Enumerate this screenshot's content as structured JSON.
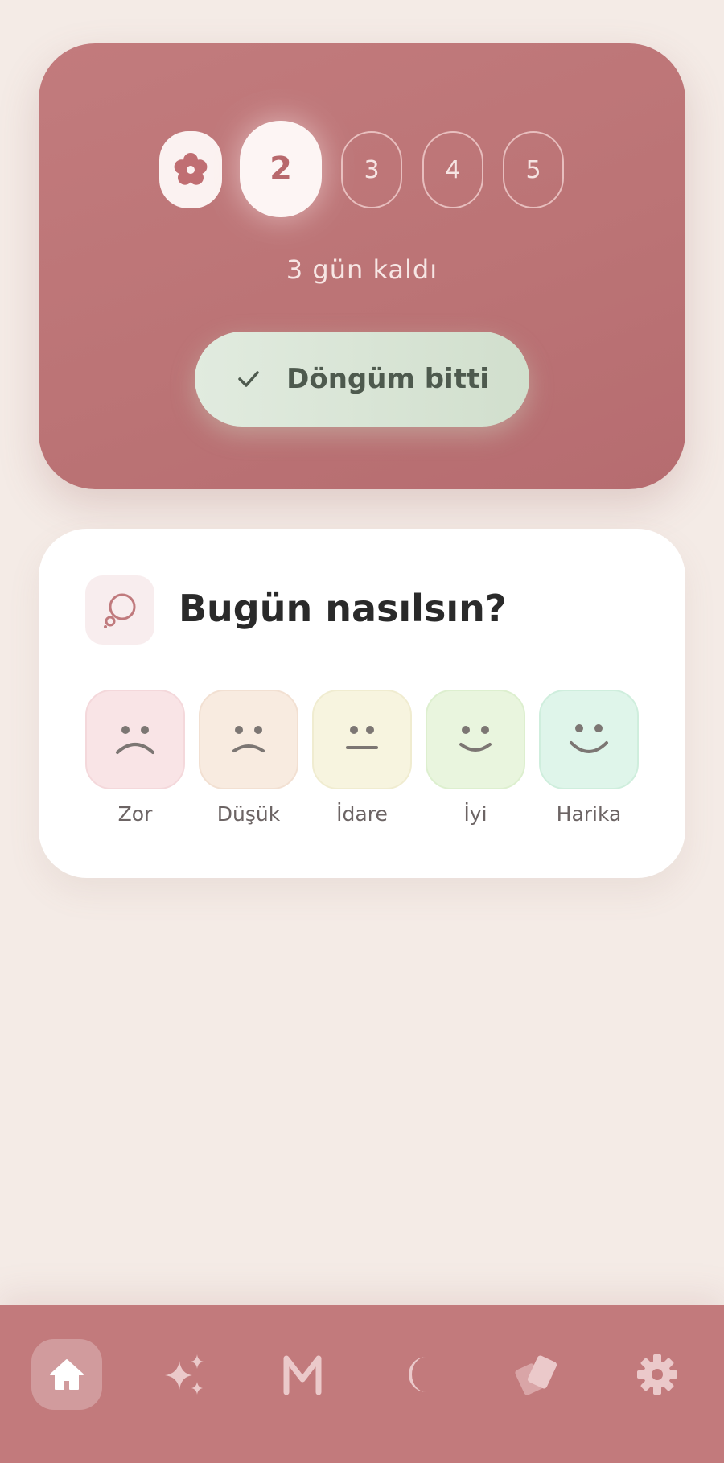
{
  "cycle": {
    "steps": [
      {
        "icon": "flower-icon",
        "state": "done"
      },
      {
        "label": "2",
        "state": "current"
      },
      {
        "label": "3",
        "state": "upcoming"
      },
      {
        "label": "4",
        "state": "upcoming"
      },
      {
        "label": "5",
        "state": "upcoming"
      }
    ],
    "days_left_text": "3 gün kaldı",
    "finish_button": {
      "icon": "check-icon",
      "label": "Döngüm bitti"
    }
  },
  "mood": {
    "icon": "thought-bubble-icon",
    "title": "Bugün nasılsın?",
    "options": [
      {
        "label": "Zor",
        "icon": "sad-face-icon",
        "color": "#f9e4e6"
      },
      {
        "label": "Düşük",
        "icon": "frown-face-icon",
        "color": "#f8ebe0"
      },
      {
        "label": "İdare",
        "icon": "neutral-face-icon",
        "color": "#f7f4df"
      },
      {
        "label": "İyi",
        "icon": "smile-face-icon",
        "color": "#e9f5de"
      },
      {
        "label": "Harika",
        "icon": "happy-face-icon",
        "color": "#dff5ea"
      }
    ]
  },
  "nav": {
    "items": [
      {
        "icon": "home-icon",
        "active": true
      },
      {
        "icon": "sparkles-icon",
        "active": false
      },
      {
        "icon": "letter-m-icon",
        "active": false
      },
      {
        "icon": "moon-icon",
        "active": false
      },
      {
        "icon": "cards-icon",
        "active": false
      },
      {
        "icon": "gear-icon",
        "active": false
      }
    ]
  },
  "colors": {
    "background": "#f4ebe6",
    "accent": "#c27a7c",
    "button_green": "#d6e3d3"
  }
}
